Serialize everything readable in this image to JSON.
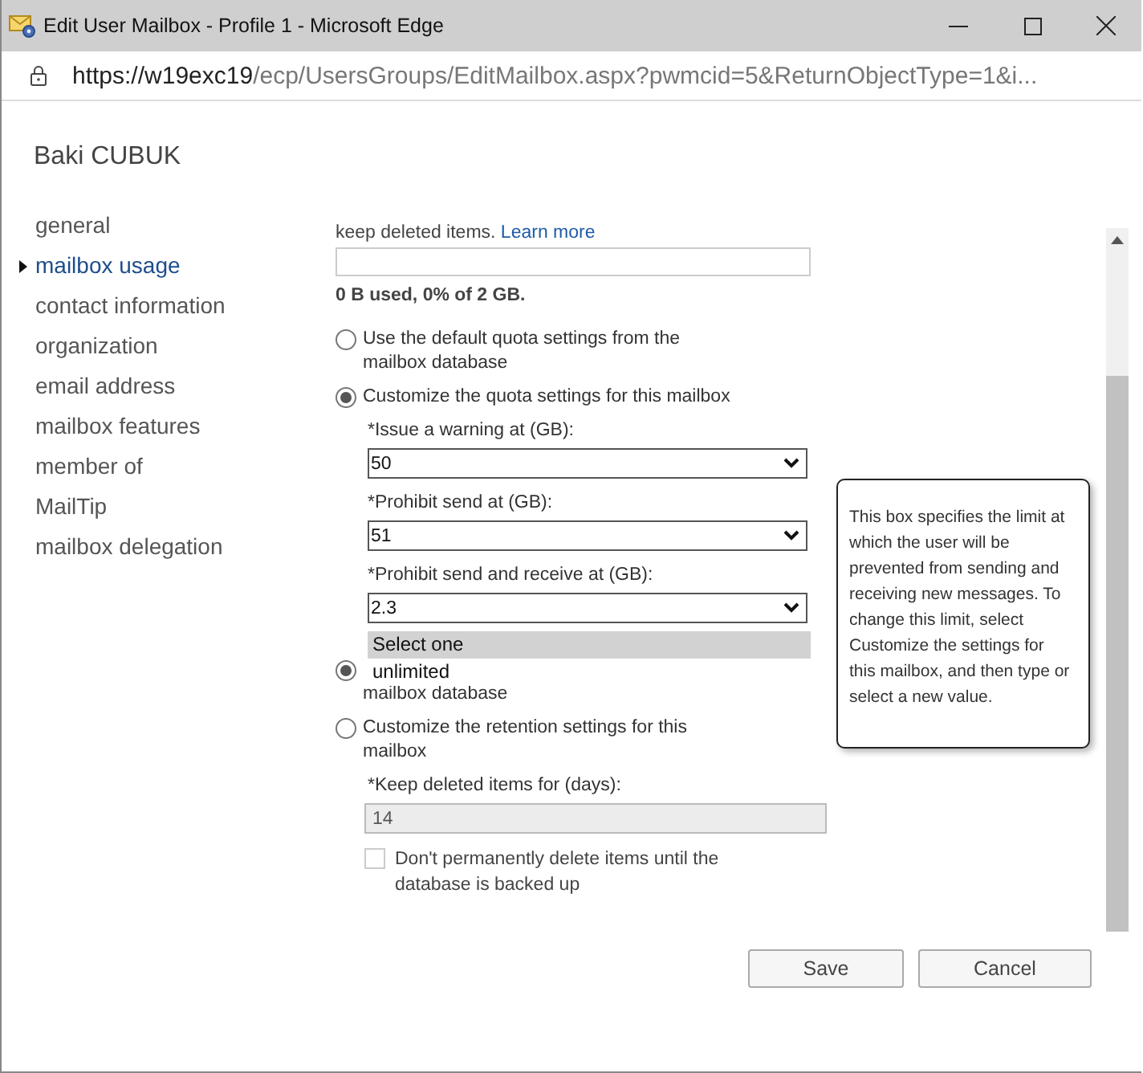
{
  "window": {
    "title": "Edit User Mailbox - Profile 1 - Microsoft Edge"
  },
  "address_bar": {
    "host": "https://w19exc19",
    "path": "/ecp/UsersGroups/EditMailbox.aspx?pwmcid=5&ReturnObjectType=1&i..."
  },
  "user_name": "Baki CUBUK",
  "nav": [
    {
      "label": "general",
      "selected": false
    },
    {
      "label": "mailbox usage",
      "selected": true
    },
    {
      "label": "contact information",
      "selected": false
    },
    {
      "label": "organization",
      "selected": false
    },
    {
      "label": "email address",
      "selected": false
    },
    {
      "label": "mailbox features",
      "selected": false
    },
    {
      "label": "member of",
      "selected": false
    },
    {
      "label": "MailTip",
      "selected": false
    },
    {
      "label": "mailbox delegation",
      "selected": false
    }
  ],
  "intro": {
    "text": "keep deleted items.",
    "link": "Learn more"
  },
  "usage": {
    "level": 0,
    "text": "0 B used, 0% of 2 GB."
  },
  "quota_options": [
    {
      "label": "Use the default quota settings from the mailbox database",
      "selected": false
    },
    {
      "label": "Customize the quota settings for this mailbox",
      "selected": true
    }
  ],
  "quota_fields": [
    {
      "label": "*Issue a warning at (GB):",
      "value": "50"
    },
    {
      "label": "*Prohibit send at (GB):",
      "value": "51"
    },
    {
      "label": "*Prohibit send and receive at (GB):",
      "value": "2.3",
      "options": [
        {
          "label": "Select one",
          "selected": true
        },
        {
          "label": "unlimited",
          "selected": false
        }
      ]
    }
  ],
  "retention_options": [
    {
      "label": "mailbox database",
      "selected": true
    },
    {
      "label": "Customize the retention settings for this mailbox",
      "selected": false
    }
  ],
  "retention_field": {
    "label": "*Keep deleted items for (days):",
    "value": "14",
    "disabled": true
  },
  "checkbox": {
    "label": "Don't permanently delete items until the database is backed up",
    "checked": false,
    "disabled": true
  },
  "tooltip": "This box specifies the limit at which the user will be prevented from sending and receiving new messages. To change this limit, select Customize the settings for this mailbox, and then type or select a new value.",
  "buttons": [
    "Save",
    "Cancel"
  ]
}
